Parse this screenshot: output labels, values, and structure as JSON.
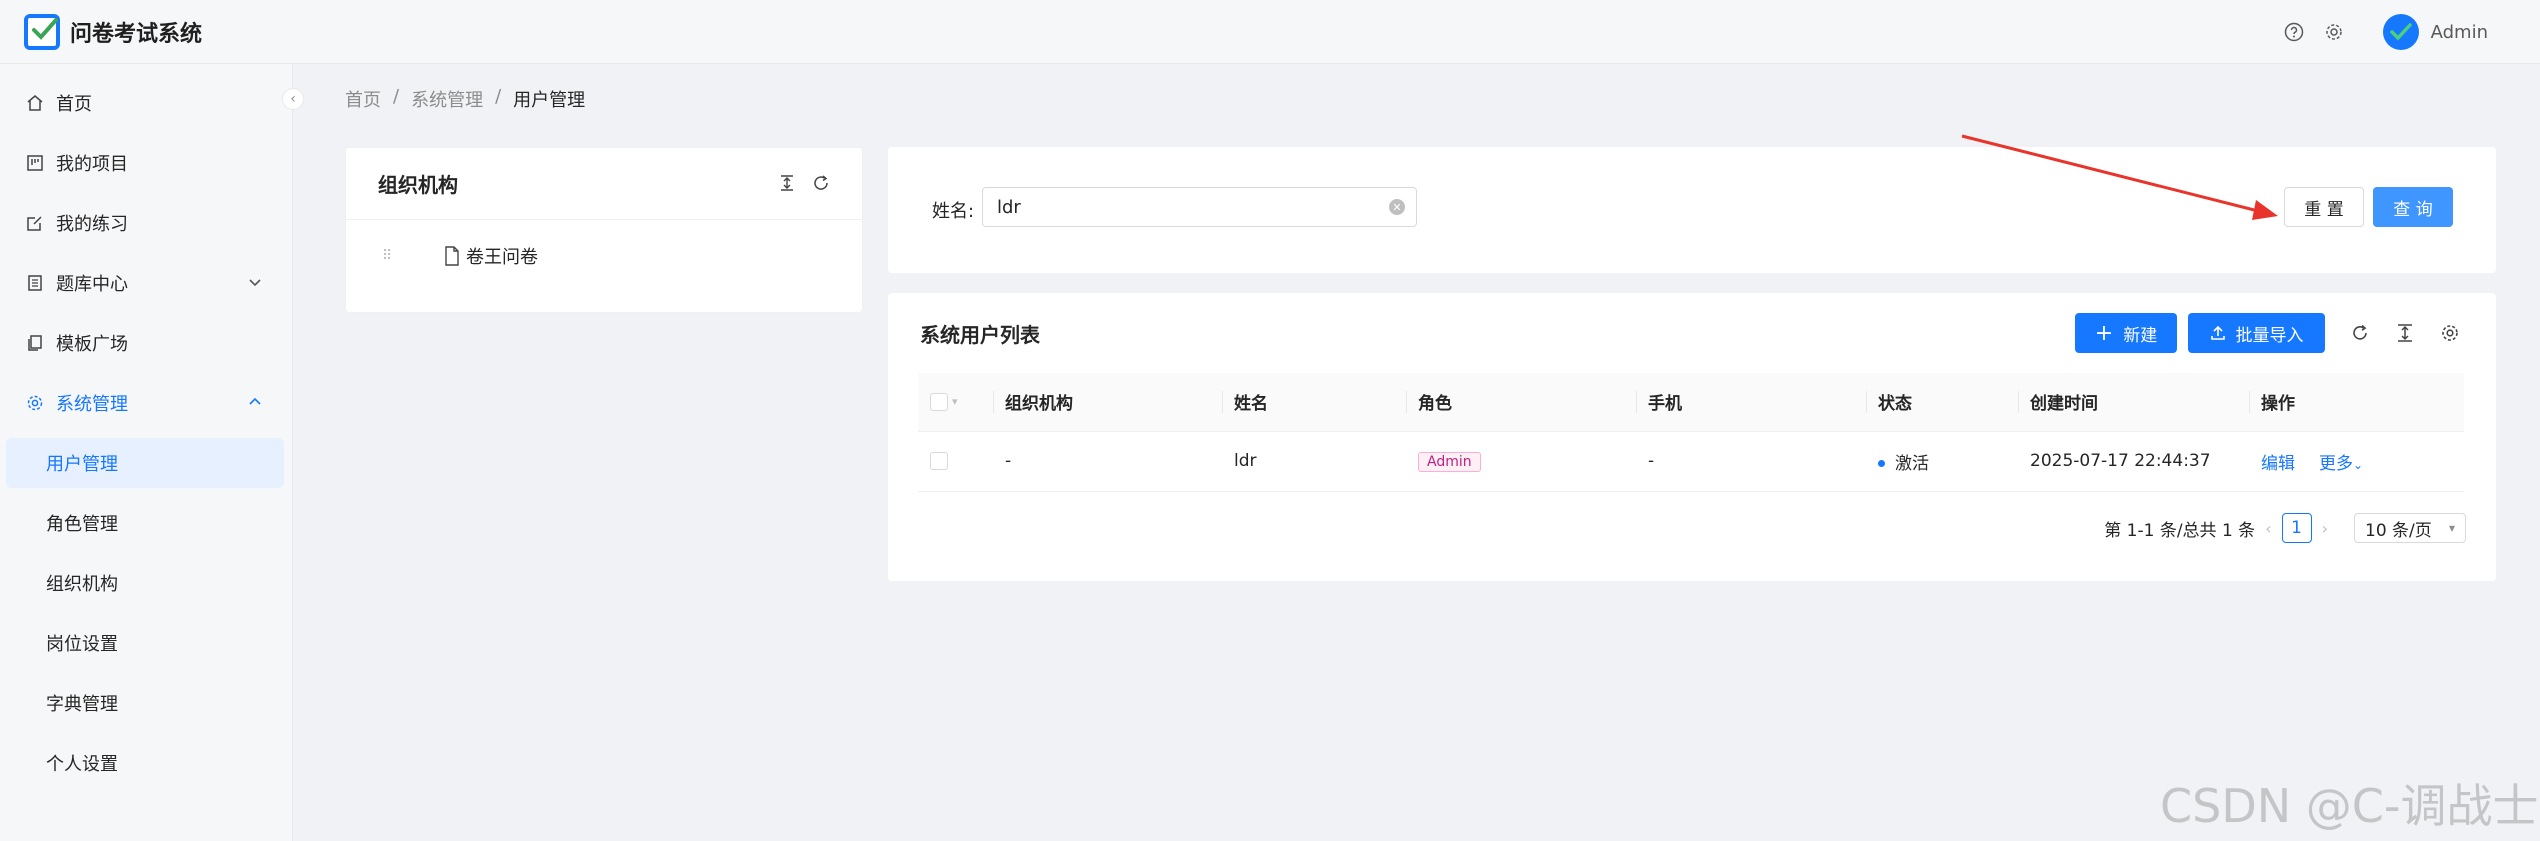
{
  "app": {
    "title": "问卷考试系统",
    "user": "Admin",
    "accent": "#1677ff"
  },
  "sidebar": {
    "items": [
      {
        "label": "首页",
        "icon": "home-icon"
      },
      {
        "label": "我的项目",
        "icon": "project-icon"
      },
      {
        "label": "我的练习",
        "icon": "edit-icon"
      },
      {
        "label": "题库中心",
        "icon": "list-icon"
      },
      {
        "label": "模板广场",
        "icon": "copy-icon"
      },
      {
        "label": "系统管理",
        "icon": "gear-icon"
      }
    ],
    "sub_items": [
      "用户管理",
      "角色管理",
      "组织机构",
      "岗位设置",
      "字典管理",
      "个人设置"
    ]
  },
  "breadcrumb": {
    "home": "首页",
    "section": "系统管理",
    "current": "用户管理",
    "sep": "/"
  },
  "org": {
    "title": "组织机构",
    "node": "卷王问卷"
  },
  "search": {
    "label": "姓名:",
    "value": "ldr",
    "reset": "重 置",
    "query": "查 询"
  },
  "table": {
    "title": "系统用户列表",
    "new_label": "新建",
    "import_label": "批量导入",
    "columns": [
      "组织机构",
      "姓名",
      "角色",
      "手机",
      "状态",
      "创建时间",
      "操作"
    ],
    "rows": [
      {
        "org": "-",
        "name": "ldr",
        "role": "Admin",
        "phone": "-",
        "status": "激活",
        "created": "2025-07-17 22:44:37",
        "edit": "编辑",
        "more": "更多"
      }
    ]
  },
  "pagination": {
    "summary": "第 1-1 条/总共 1 条",
    "page": "1",
    "page_size": "10 条/页"
  },
  "watermark": "CSDN @C-调战士"
}
